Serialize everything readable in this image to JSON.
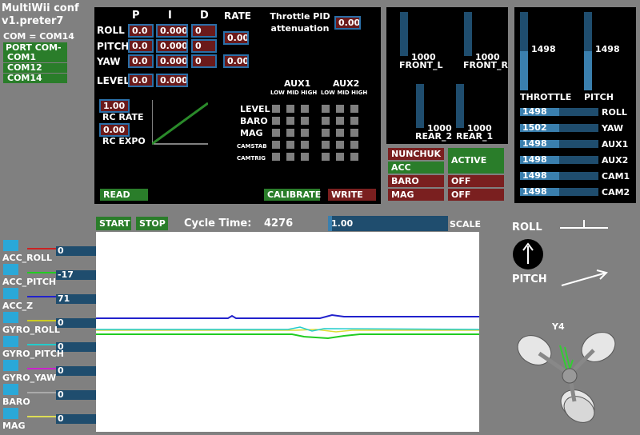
{
  "app": {
    "title_line1": "MultiWii conf",
    "title_line2": "v1.preter7"
  },
  "com": {
    "current": "COM = COM14",
    "port_label": "PORT COM",
    "port_dash": "-",
    "ports": [
      "COM1",
      "COM12",
      "COM14"
    ]
  },
  "pid": {
    "headers": [
      "P",
      "I",
      "D"
    ],
    "rate_header": "RATE",
    "rows": [
      {
        "name": "ROLL",
        "p": "0.0",
        "i": "0.000",
        "d": "0"
      },
      {
        "name": "PITCH",
        "p": "0.0",
        "i": "0.000",
        "d": "0"
      },
      {
        "name": "YAW",
        "p": "0.0",
        "i": "0.000",
        "d": "0"
      },
      {
        "name": "LEVEL",
        "p": "0.0",
        "i": "0.000"
      }
    ],
    "roll_pitch_rate": "0.00",
    "yaw_rate": "0.00",
    "throttle_label": "Throttle PID attenuation",
    "throttle_value": "0.00",
    "rc_rate_value": "1.00",
    "rc_rate_label": "RC RATE",
    "rc_expo_value": "0.00",
    "rc_expo_label": "RC EXPO"
  },
  "aux": {
    "aux1": "AUX1",
    "aux2": "AUX2",
    "sub": "LOW MID HIGH",
    "modes": [
      "LEVEL",
      "BARO",
      "MAG",
      "CAMSTAB",
      "CAMTRIG"
    ]
  },
  "buttons": {
    "read": "READ",
    "calibrate": "CALIBRATE",
    "write": "WRITE",
    "start": "START",
    "stop": "STOP"
  },
  "motors": {
    "front_l": "FRONT_L",
    "front_l_value": "1000",
    "front_r": "FRONT_R",
    "front_r_value": "1000",
    "rear_2": "REAR_2",
    "rear_2_value": "1000",
    "rear_1": "REAR_1",
    "rear_1_value": "1000"
  },
  "sensors_status": {
    "nunchuk": "NUNCHUK",
    "acc": "ACC",
    "baro": "BARO",
    "mag": "MAG",
    "active": "ACTIVE",
    "off1": "OFF",
    "off2": "OFF"
  },
  "rc": {
    "throttle_label": "THROTTLE",
    "throttle_value": "1498",
    "throttle_level": 0.5,
    "pitch_label": "PITCH",
    "pitch_value": "1498",
    "pitch_level": 0.5,
    "channels": [
      {
        "name": "ROLL",
        "value": "1498",
        "level": 0.5
      },
      {
        "name": "YAW",
        "value": "1502",
        "level": 0.5
      },
      {
        "name": "AUX1",
        "value": "1498",
        "level": 0.5
      },
      {
        "name": "AUX2",
        "value": "1498",
        "level": 0.5
      },
      {
        "name": "CAM1",
        "value": "1498",
        "level": 0.5
      },
      {
        "name": "CAM2",
        "value": "1498",
        "level": 0.5
      }
    ]
  },
  "graph": {
    "cycle_label": "Cycle Time:",
    "cycle_value": "4276",
    "scale_value": "1.00",
    "scale_label": "SCALE"
  },
  "signals": [
    {
      "name": "ACC_ROLL",
      "value": "0",
      "color": "#cc2222"
    },
    {
      "name": "ACC_PITCH",
      "value": "-17",
      "color": "#22cc22"
    },
    {
      "name": "ACC_Z",
      "value": "71",
      "color": "#2222cc"
    },
    {
      "name": "GYRO_ROLL",
      "value": "0",
      "color": "#cccc22"
    },
    {
      "name": "GYRO_PITCH",
      "value": "0",
      "color": "#22cccc"
    },
    {
      "name": "GYRO_YAW",
      "value": "0",
      "color": "#cc22cc"
    },
    {
      "name": "BARO",
      "value": "0",
      "color": "#aaaaaa"
    },
    {
      "name": "MAG",
      "value": "0",
      "color": "#dddd55"
    }
  ],
  "attitude": {
    "roll_label": "ROLL",
    "pitch_label": "PITCH",
    "model": "Y4"
  }
}
